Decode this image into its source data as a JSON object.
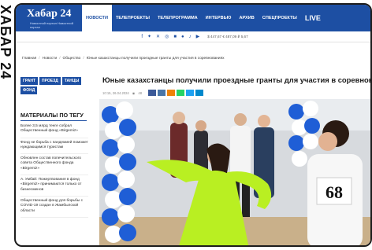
{
  "edge": {
    "text": "ХАБАР 24"
  },
  "header": {
    "logo": "Хабар 24",
    "logo_sub": "Новостной портал Новостной портал",
    "nav": [
      {
        "label": "НОВОСТИ",
        "active": true
      },
      {
        "label": "ТЕЛЕПРОЕКТЫ",
        "active": false
      },
      {
        "label": "ТЕЛЕПРОГРАММА",
        "active": false
      },
      {
        "label": "ИНТЕРВЬЮ",
        "active": false
      },
      {
        "label": "АРХИВ",
        "active": false
      },
      {
        "label": "СПЕЦПРОЕКТЫ",
        "active": false
      },
      {
        "label": "LIVE",
        "active": false
      }
    ],
    "accent": "#1d4fa3"
  },
  "social": {
    "icons": [
      "facebook-icon",
      "twitter-icon",
      "vk-icon",
      "instagram-icon",
      "ok-icon",
      "telegram-icon",
      "tiktok-icon",
      "youtube-icon"
    ],
    "rates": "$ 447,67 € 487,09 ₽ 5,67"
  },
  "breadcrumb": [
    "Главная",
    "Новости",
    "Общество",
    "Юные казахстанцы получили проездные гранты для участия в соревнованиях"
  ],
  "tags": [
    "ГРАНТ",
    "ПРОЕЗД",
    "ТАНЦЫ",
    "ФОНД"
  ],
  "sidebar": {
    "title": "МАТЕРИАЛЫ ПО ТЕГУ",
    "items": [
      "Более 3,5 млрд тенге собрал Общественный фонд «Birgemiz»",
      "Фонд не борьба с пандемией поможет нуждающимся туристам",
      "Обновлен состав попечительского совета Общественного фонда «Birgemiz»",
      "А. Умбай: Пожертвования в фонд «Birgemiz» принимаются только от бизнесменов",
      "Общественный фонд для борьбы с COVID-19 создан в Жамбылской области"
    ]
  },
  "article": {
    "headline": "Юные казахстанцы получили проездные гранты для участия в соревнованиях",
    "date": "10:15, 26.04.2024",
    "views": "48",
    "share_colors": [
      "#3b5998",
      "#4a76a8",
      "#ee8208",
      "#25d366",
      "#1da1f2",
      "#0088cc"
    ],
    "photo_number": "68"
  }
}
